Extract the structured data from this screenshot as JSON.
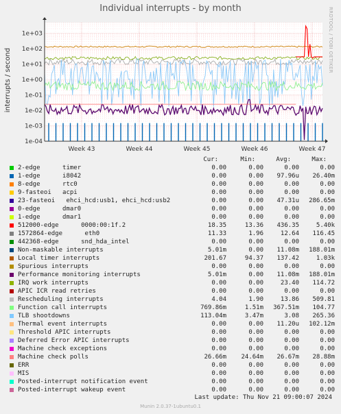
{
  "title": "Individual interrupts - by month",
  "watermark": "RRDTOOL / TOBI OETIKER",
  "chart_data": {
    "type": "line",
    "y_scale": "log",
    "ylabel": "interrupts / second",
    "ylim": [
      0.0001,
      5000
    ],
    "y_ticks": [
      "1e+03",
      "1e+02",
      "1e+01",
      "1e+00",
      "1e-01",
      "1e-02",
      "1e-03",
      "1e-04"
    ],
    "x_ticks": [
      "Week 43",
      "Week 44",
      "Week 45",
      "Week 46",
      "Week 47"
    ],
    "grid": true,
    "series_style": [
      {
        "name": "Local timer interrupts",
        "color": "#cc7a00",
        "level": 137,
        "jitter": 0.05
      },
      {
        "name": "Rescheduling interrupts",
        "color": "#aaaaaa",
        "level": 14,
        "jitter": 0.2
      },
      {
        "name": "442368-edge snd_hda_intel",
        "color": "#88b020",
        "level": 25,
        "jitter": 0.1
      },
      {
        "name": "TLB shootdowns",
        "color": "#88c8f8",
        "level": 3,
        "jitter": 0.9
      },
      {
        "name": "Function call interrupts",
        "color": "#90f090",
        "level": 0.4,
        "jitter": 0.3
      },
      {
        "name": "Performance monitoring interrupts",
        "color": "#5a0a70",
        "level": 0.011,
        "jitter": 0.35
      },
      {
        "name": "512000-edge 0000:00:1f.2",
        "color": "#ff0000",
        "level": 0.025,
        "jitter": 0
      },
      {
        "name": "1-edge i8042",
        "color": "#0066b3",
        "level": 0.0001,
        "jitter": 0
      }
    ]
  },
  "legend": {
    "headers": {
      "cur": "Cur:",
      "min": "Min:",
      "avg": "Avg:",
      "max": "Max:"
    },
    "rows": [
      {
        "label": "2-edge      timer",
        "color": "#00cc00",
        "cur": "0.00",
        "min": "0.00",
        "avg": "0.00",
        "max": "0.00"
      },
      {
        "label": "1-edge      i8042",
        "color": "#0066b3",
        "cur": "0.00",
        "min": "0.00",
        "avg": "97.96u",
        "max": "26.40m"
      },
      {
        "label": "8-edge      rtc0",
        "color": "#ff8000",
        "cur": "0.00",
        "min": "0.00",
        "avg": "0.00",
        "max": "0.00"
      },
      {
        "label": "9-fasteoi   acpi",
        "color": "#ffcc00",
        "cur": "0.00",
        "min": "0.00",
        "avg": "0.00",
        "max": "0.00"
      },
      {
        "label": "23-fasteoi   ehci_hcd:usb1, ehci_hcd:usb2",
        "color": "#330099",
        "cur": "0.00",
        "min": "0.00",
        "avg": "47.31u",
        "max": "286.65m"
      },
      {
        "label": "0-edge      dmar0",
        "color": "#990099",
        "cur": "0.00",
        "min": "0.00",
        "avg": "0.00",
        "max": "0.00"
      },
      {
        "label": "1-edge      dmar1",
        "color": "#ccff00",
        "cur": "0.00",
        "min": "0.00",
        "avg": "0.00",
        "max": "0.00"
      },
      {
        "label": "512000-edge      0000:00:1f.2",
        "color": "#ff0000",
        "cur": "18.35",
        "min": "13.36",
        "avg": "436.35",
        "max": "5.40k"
      },
      {
        "label": "1572864-edge      eth0",
        "color": "#808080",
        "cur": "11.33",
        "min": "1.96",
        "avg": "12.64",
        "max": "116.45"
      },
      {
        "label": "442368-edge      snd_hda_intel",
        "color": "#008f00",
        "cur": "0.00",
        "min": "0.00",
        "avg": "0.00",
        "max": "0.00"
      },
      {
        "label": "Non-maskable interrupts",
        "color": "#00487d",
        "cur": "5.01m",
        "min": "0.00",
        "avg": "11.08m",
        "max": "188.01m"
      },
      {
        "label": "Local timer interrupts",
        "color": "#b35a00",
        "cur": "201.67",
        "min": "94.37",
        "avg": "137.42",
        "max": "1.03k"
      },
      {
        "label": "Spurious interrupts",
        "color": "#b38f00",
        "cur": "0.00",
        "min": "0.00",
        "avg": "0.00",
        "max": "0.00"
      },
      {
        "label": "Performance monitoring interrupts",
        "color": "#6b006b",
        "cur": "5.01m",
        "min": "0.00",
        "avg": "11.08m",
        "max": "188.01m"
      },
      {
        "label": "IRQ work interrupts",
        "color": "#8fb300",
        "cur": "0.00",
        "min": "0.00",
        "avg": "23.40",
        "max": "114.72"
      },
      {
        "label": "APIC ICR read retries",
        "color": "#b30000",
        "cur": "0.00",
        "min": "0.00",
        "avg": "0.00",
        "max": "0.00"
      },
      {
        "label": "Rescheduling interrupts",
        "color": "#bebebe",
        "cur": "4.04",
        "min": "1.90",
        "avg": "13.86",
        "max": "509.81"
      },
      {
        "label": "Function call interrupts",
        "color": "#80ff80",
        "cur": "769.86m",
        "min": "1.51m",
        "avg": "367.51m",
        "max": "104.77"
      },
      {
        "label": "TLB shootdowns",
        "color": "#80c9ff",
        "cur": "113.04m",
        "min": "3.47m",
        "avg": "3.08",
        "max": "265.36"
      },
      {
        "label": "Thermal event interrupts",
        "color": "#ffc080",
        "cur": "0.00",
        "min": "0.00",
        "avg": "11.20u",
        "max": "102.12m"
      },
      {
        "label": "Threshold APIC interrupts",
        "color": "#ffe680",
        "cur": "0.00",
        "min": "0.00",
        "avg": "0.00",
        "max": "0.00"
      },
      {
        "label": "Deferred Error APIC interrupts",
        "color": "#aa80ff",
        "cur": "0.00",
        "min": "0.00",
        "avg": "0.00",
        "max": "0.00"
      },
      {
        "label": "Machine check exceptions",
        "color": "#ee00cc",
        "cur": "0.00",
        "min": "0.00",
        "avg": "0.00",
        "max": "0.00"
      },
      {
        "label": "Machine check polls",
        "color": "#ff8080",
        "cur": "26.66m",
        "min": "24.64m",
        "avg": "26.67m",
        "max": "28.88m"
      },
      {
        "label": "ERR",
        "color": "#666600",
        "cur": "0.00",
        "min": "0.00",
        "avg": "0.00",
        "max": "0.00"
      },
      {
        "label": "MIS",
        "color": "#ffbfff",
        "cur": "0.00",
        "min": "0.00",
        "avg": "0.00",
        "max": "0.00"
      },
      {
        "label": "Posted-interrupt notification event",
        "color": "#00ffcc",
        "cur": "0.00",
        "min": "0.00",
        "avg": "0.00",
        "max": "0.00"
      },
      {
        "label": "Posted-interrupt wakeup event",
        "color": "#cc6699",
        "cur": "0.00",
        "min": "0.00",
        "avg": "0.00",
        "max": "0.00"
      }
    ]
  },
  "footer": {
    "last_update": "Last update: Thu Nov 21 09:00:07 2024",
    "munin": "Munin 2.0.37-1ubuntu0.1"
  }
}
